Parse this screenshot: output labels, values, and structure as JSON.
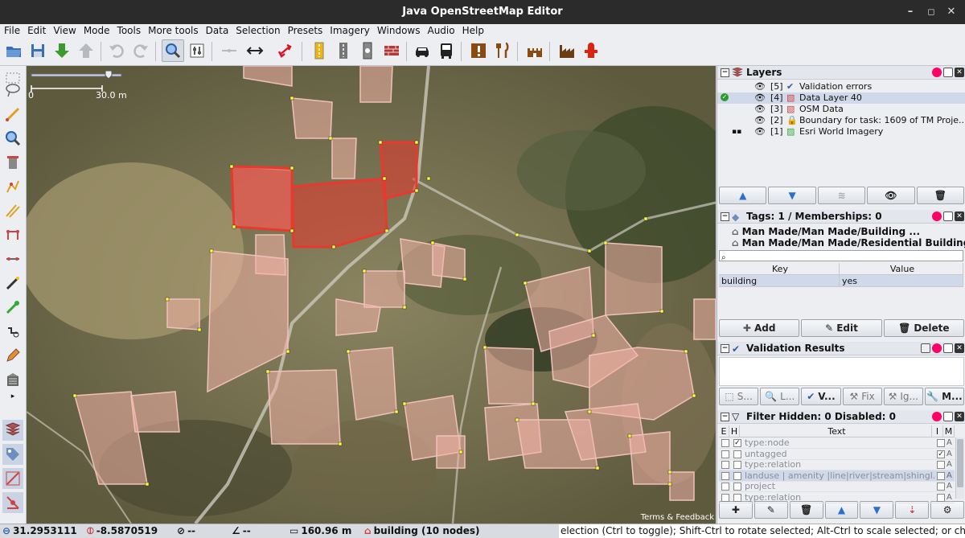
{
  "window": {
    "title": "Java OpenStreetMap Editor"
  },
  "menu": [
    "File",
    "Edit",
    "View",
    "Mode",
    "Tools",
    "More tools",
    "Data",
    "Selection",
    "Presets",
    "Imagery",
    "Windows",
    "Audio",
    "Help"
  ],
  "map": {
    "scale_start": "0",
    "scale_end": "30.0 m",
    "terms": "Terms & Feedback"
  },
  "layers": {
    "title": "Layers",
    "items": [
      {
        "index": "[5]",
        "name": "Validation errors"
      },
      {
        "index": "[4]",
        "name": "Data Layer 40"
      },
      {
        "index": "[3]",
        "name": "OSM Data"
      },
      {
        "index": "[2]",
        "name": "Boundary for task: 1609 of TM Proje..."
      },
      {
        "index": "[1]",
        "name": "Esri World Imagery"
      }
    ]
  },
  "tags": {
    "title": "Tags: 1 / Memberships: 0",
    "presets": [
      "Man Made/Man Made/Building ...",
      "Man Made/Man Made/Residential Building ..."
    ],
    "key_header": "Key",
    "value_header": "Value",
    "rows": [
      {
        "key": "building",
        "value": "yes"
      }
    ],
    "add": "Add",
    "edit": "Edit",
    "delete": "Delete"
  },
  "validation": {
    "title": "Validation Results",
    "buttons": [
      "S...",
      "L...",
      "V...",
      "Fix",
      "Ig...",
      "M..."
    ]
  },
  "filter": {
    "title": "Filter Hidden: 0 Disabled: 0",
    "col_e": "E",
    "col_h": "H",
    "col_text": "Text",
    "col_i": "I",
    "col_m": "M",
    "rows": [
      {
        "text": "type:node",
        "h": "✓",
        "i": "",
        "m": "A"
      },
      {
        "text": "untagged",
        "h": "",
        "i": "✓",
        "m": "A"
      },
      {
        "text": "type:relation",
        "h": "",
        "i": "",
        "m": "A"
      },
      {
        "text": "landuse | amenity |line|river|stream|shingl...",
        "h": "",
        "i": "",
        "m": "A"
      },
      {
        "text": "project",
        "h": "",
        "i": "",
        "m": "A"
      },
      {
        "text": "type:relation",
        "h": "",
        "i": "",
        "m": "A"
      }
    ]
  },
  "status": {
    "lat": "31.2953111",
    "lon": "-8.5870519",
    "heading": "--",
    "angle": "--",
    "distance": "160.96 m",
    "selection": "building (10 nodes)",
    "help": "election (Ctrl to toggle); Shift-Ctrl to rotate selected; Alt-Ctrl to scale selected; or change selec"
  },
  "colors": {
    "accent": "#2f6fd0",
    "selected": "#e8392f",
    "building": "#f4b0a8",
    "node": "#ffff33"
  }
}
